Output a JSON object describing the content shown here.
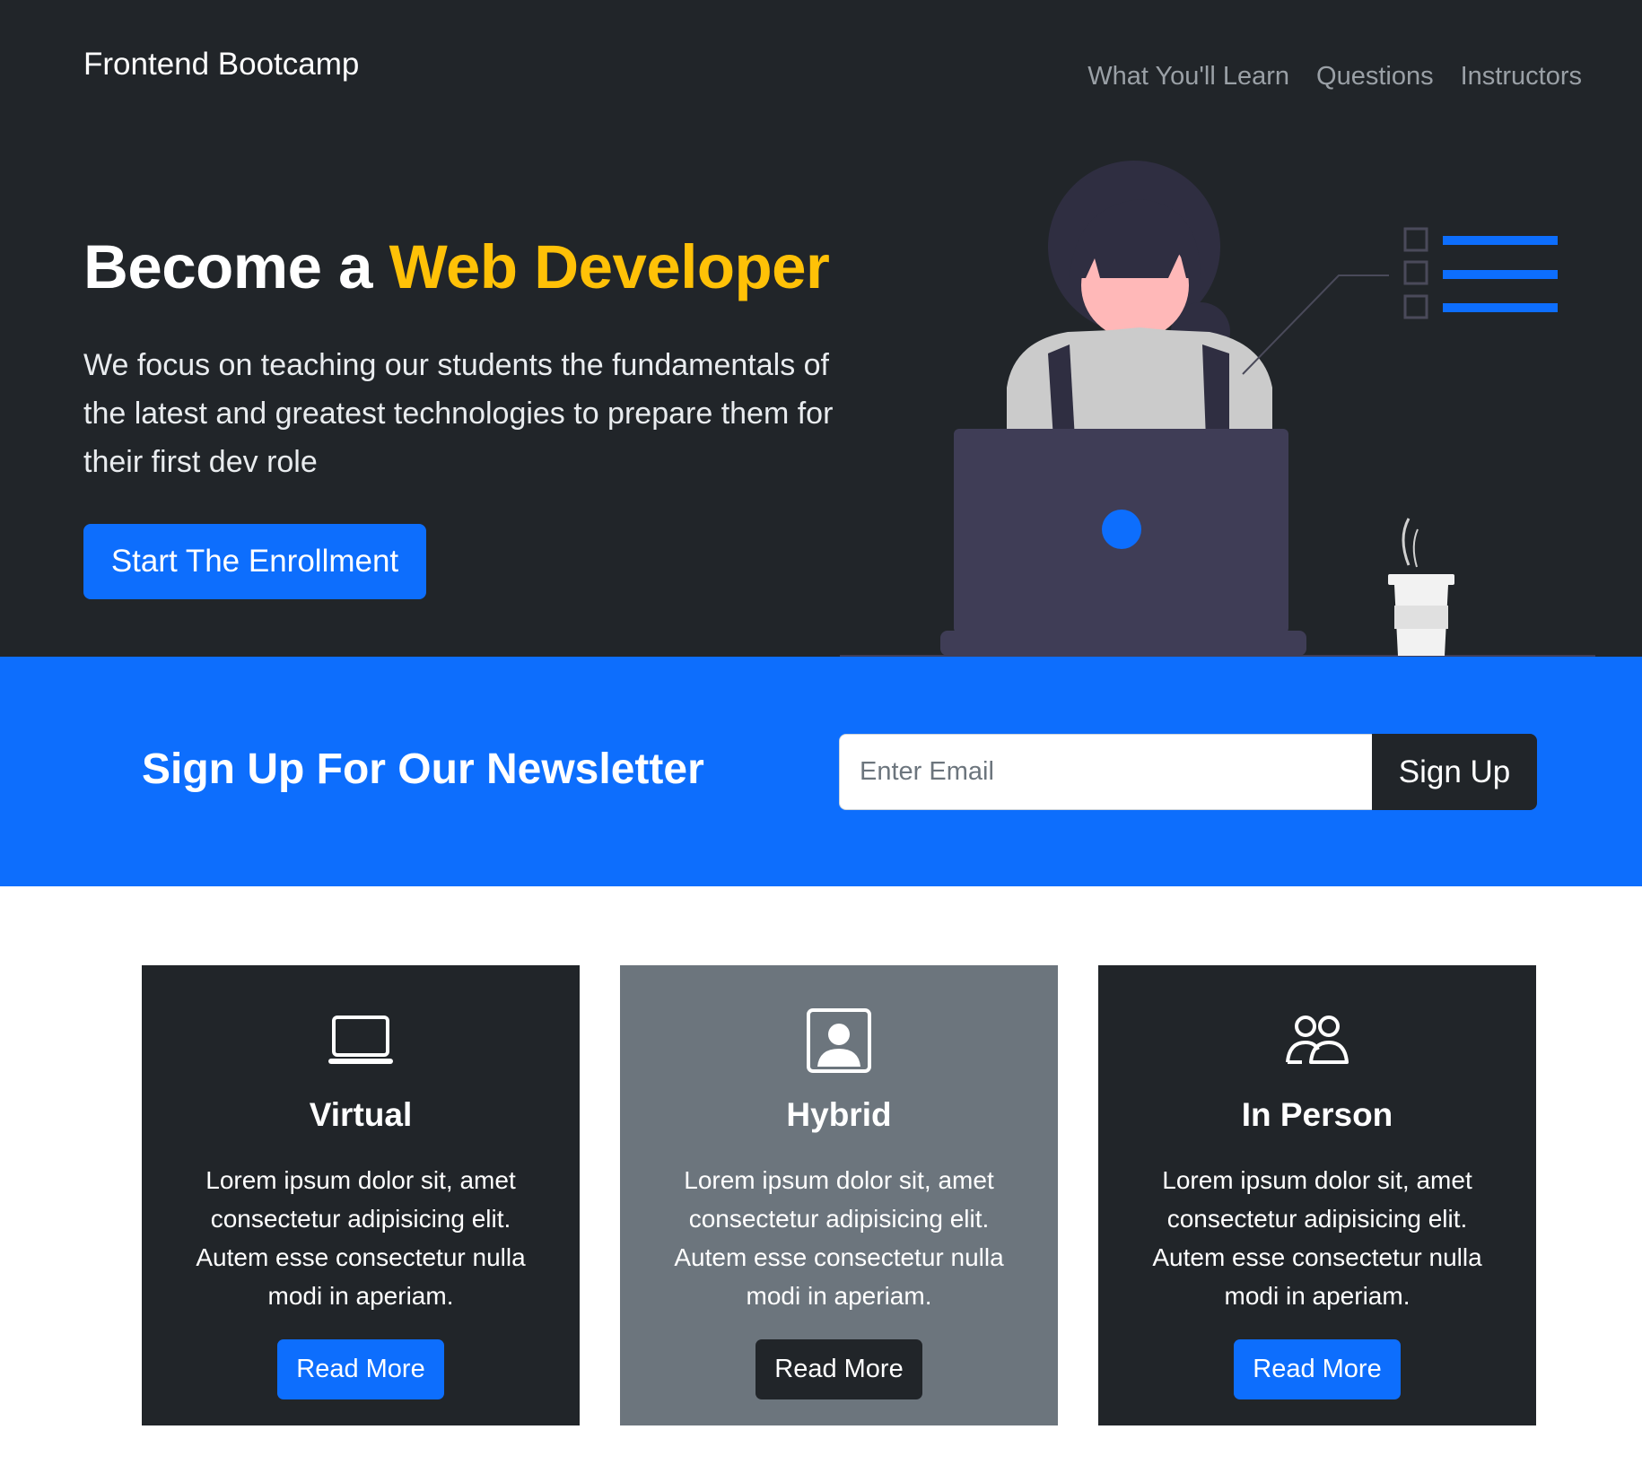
{
  "navbar": {
    "brand": "Frontend Bootcamp",
    "links": [
      "What You'll Learn",
      "Questions",
      "Instructors"
    ]
  },
  "hero": {
    "title_plain": "Become a ",
    "title_accent": "Web Developer",
    "text": "We focus on teaching our students the fundamentals of the latest and greatest technologies to prepare them for their first dev role",
    "cta_label": "Start The Enrollment"
  },
  "newsletter": {
    "title": "Sign Up For Our Newsletter",
    "email_placeholder": "Enter Email",
    "email_value": "",
    "button_label": "Sign Up"
  },
  "cards": [
    {
      "icon": "laptop-icon",
      "title": "Virtual",
      "text": "Lorem ipsum dolor sit, amet consectetur adipisicing elit. Autem esse consectetur nulla modi in aperiam.",
      "button_label": "Read More"
    },
    {
      "icon": "person-badge-icon",
      "title": "Hybrid",
      "text": "Lorem ipsum dolor sit, amet consectetur adipisicing elit. Autem esse consectetur nulla modi in aperiam.",
      "button_label": "Read More"
    },
    {
      "icon": "people-icon",
      "title": "In Person",
      "text": "Lorem ipsum dolor sit, amet consectetur adipisicing elit. Autem esse consectetur nulla modi in aperiam.",
      "button_label": "Read More"
    }
  ],
  "colors": {
    "dark": "#212529",
    "primary": "#0d6efd",
    "accent": "#ffc107",
    "grey": "#6c757d"
  }
}
